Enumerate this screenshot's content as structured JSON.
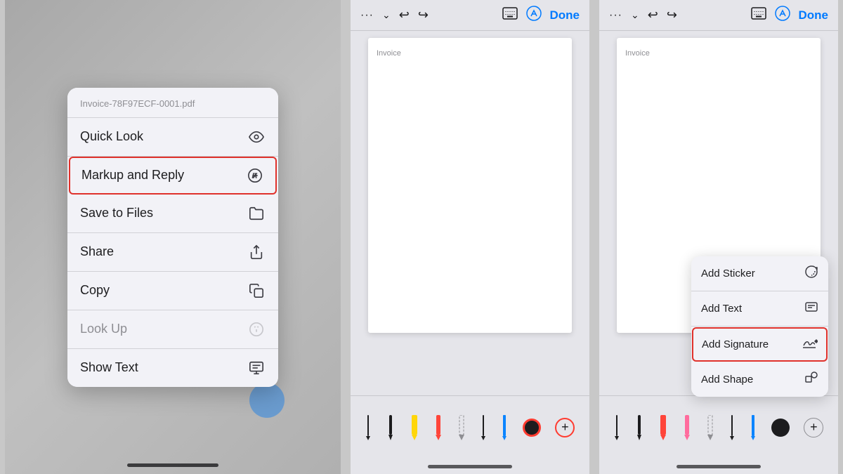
{
  "panel1": {
    "filename": "Invoice-78F97ECF-0001.pdf",
    "menu_items": [
      {
        "id": "quick-look",
        "label": "Quick Look",
        "icon": "eye",
        "highlighted": false,
        "disabled": false
      },
      {
        "id": "markup-reply",
        "label": "Markup and Reply",
        "icon": "markup",
        "highlighted": true,
        "disabled": false
      },
      {
        "id": "save-files",
        "label": "Save to Files",
        "icon": "folder",
        "highlighted": false,
        "disabled": false
      },
      {
        "id": "share",
        "label": "Share",
        "icon": "share",
        "highlighted": false,
        "disabled": false
      },
      {
        "id": "copy",
        "label": "Copy",
        "icon": "copy",
        "highlighted": false,
        "disabled": false
      },
      {
        "id": "look-up",
        "label": "Look Up",
        "icon": "info",
        "highlighted": false,
        "disabled": true
      },
      {
        "id": "show-text",
        "label": "Show Text",
        "icon": "text",
        "highlighted": false,
        "disabled": false
      }
    ]
  },
  "panel2": {
    "toolbar": {
      "dots": "···",
      "chevron": "chevron-down",
      "undo": "↩",
      "redo": "↪",
      "keyboard": "⌨",
      "markup": "markup",
      "done": "Done"
    },
    "doc": {
      "label": "Invoice"
    }
  },
  "panel3": {
    "toolbar": {
      "dots": "···",
      "chevron": "chevron-down",
      "undo": "↩",
      "redo": "↪",
      "keyboard": "⌨",
      "markup": "markup",
      "done": "Done"
    },
    "doc": {
      "label": "Invoice"
    },
    "popup": {
      "items": [
        {
          "id": "add-sticker",
          "label": "Add Sticker",
          "icon": "sticker",
          "highlighted": false
        },
        {
          "id": "add-text",
          "label": "Add Text",
          "icon": "text-box",
          "highlighted": false
        },
        {
          "id": "add-signature",
          "label": "Add Signature",
          "icon": "signature",
          "highlighted": true
        },
        {
          "id": "add-shape",
          "label": "Add Shape",
          "icon": "shape",
          "highlighted": false
        }
      ]
    }
  }
}
